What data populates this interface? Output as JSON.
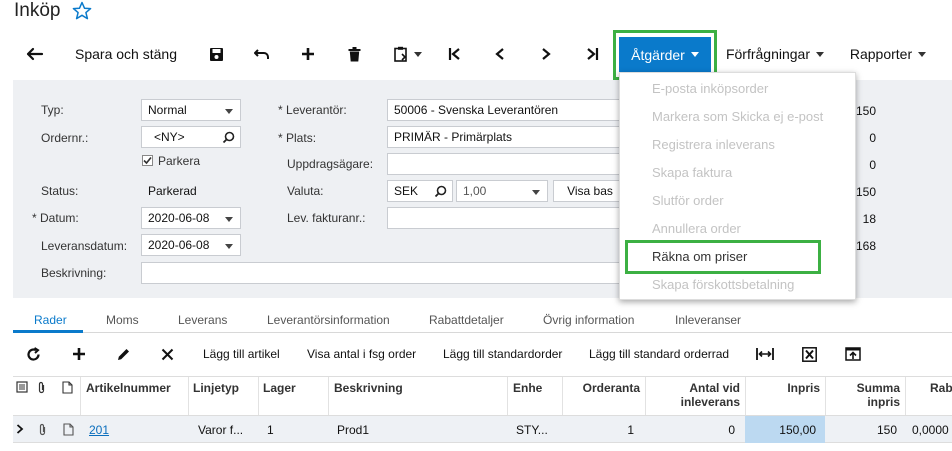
{
  "header": {
    "title": "Inköp"
  },
  "toolbar": {
    "save_close": "Spara och stäng",
    "actions": "Åtgärder",
    "inquiries": "Förfrågningar",
    "reports": "Rapporter"
  },
  "actions_menu": {
    "items": [
      "E-posta inköpsorder",
      "Markera som Skicka ej e-post",
      "Registrera inleverans",
      "Skapa faktura",
      "Slutför order",
      "Annullera order",
      "Räkna om priser",
      "Skapa förskottsbetalning"
    ]
  },
  "form": {
    "typ_label": "Typ:",
    "typ_value": "Normal",
    "ordernr_label": "Ordernr.:",
    "ordernr_value": "<NY>",
    "parkera_label": "Parkera",
    "status_label": "Status:",
    "status_value": "Parkerad",
    "datum_label": "Datum:",
    "datum_value": "2020-06-08",
    "leveransdatum_label": "Leveransdatum:",
    "leveransdatum_value": "2020-06-08",
    "beskrivning_label": "Beskrivning:",
    "leverantor_label": "Leverantör:",
    "leverantor_value": "50006 - Svenska Leverantören",
    "plats_label": "Plats:",
    "plats_value": "PRIMÄR - Primärplats",
    "uppdragsagare_label": "Uppdragsägare:",
    "valuta_label": "Valuta:",
    "valuta_code": "SEK",
    "valuta_rate": "1,00",
    "visa_bas": "Visa bas",
    "lev_faktura_label": "Lev. fakturanr.:",
    "right_values": [
      "150",
      "0",
      "0",
      "150",
      "18",
      "168"
    ]
  },
  "tabs": [
    "Rader",
    "Moms",
    "Leverans",
    "Leverantörsinformation",
    "Rabattdetaljer",
    "Övrig information",
    "Inleveranser"
  ],
  "grid_toolbar": {
    "add_article": "Lägg till artikel",
    "show_qty": "Visa antal i fsg order",
    "add_std_order": "Lägg till standardorder",
    "add_std_row": "Lägg till standard orderrad"
  },
  "grid": {
    "columns": [
      "Artikelnummer",
      "Linjetyp",
      "Lager",
      "Beskrivning",
      "Enhe",
      "Orderanta",
      "Antal vid",
      "inleverans",
      "Inpris",
      "Summa",
      "inpris",
      "Rab"
    ],
    "row": {
      "artikelnummer": "201",
      "linjetyp": "Varor f...",
      "lager": "1",
      "beskrivning": "Prod1",
      "enhet": "STY...",
      "orderantal": "1",
      "antal_inleverans": "0",
      "inpris": "150,00",
      "summa_inpris": "150",
      "rabatt": "0,0000"
    }
  },
  "colors": {
    "accent": "#0a7acb",
    "highlight": "#3cb043",
    "selected_cell": "#bcd9f1"
  }
}
